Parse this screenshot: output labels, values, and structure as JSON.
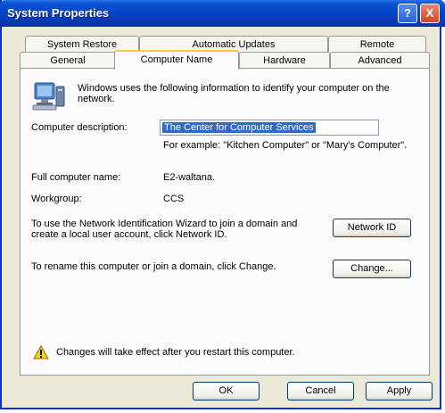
{
  "window": {
    "title": "System Properties",
    "help_label": "?",
    "close_label": "X"
  },
  "tabs_back": [
    {
      "label": "System Restore"
    },
    {
      "label": "Automatic Updates"
    },
    {
      "label": "Remote"
    }
  ],
  "tabs_front": [
    {
      "label": "General"
    },
    {
      "label": "Computer Name",
      "active": true
    },
    {
      "label": "Hardware"
    },
    {
      "label": "Advanced"
    }
  ],
  "intro": {
    "text": "Windows uses the following information to identify your computer on the network."
  },
  "description": {
    "label": "Computer description:",
    "value": "The Center for Computer Services",
    "example": "For example: \"Kitchen Computer\" or \"Mary's Computer\"."
  },
  "full_name": {
    "label": "Full computer name:",
    "value": "E2-waltana."
  },
  "workgroup": {
    "label": "Workgroup:",
    "value": "CCS"
  },
  "network_id": {
    "text": "To use the Network Identification Wizard to join a domain and create a local user account, click Network ID.",
    "button": "Network ID"
  },
  "rename": {
    "text": "To rename this computer or join a domain, click Change.",
    "button": "Change..."
  },
  "warning": {
    "text": "Changes will take effect after you restart this computer."
  },
  "footer": {
    "ok": "OK",
    "cancel": "Cancel",
    "apply": "Apply"
  },
  "colors": {
    "titlebar": "#0542c4",
    "dialog_bg": "#ece9d8",
    "selection": "#316ac5"
  }
}
